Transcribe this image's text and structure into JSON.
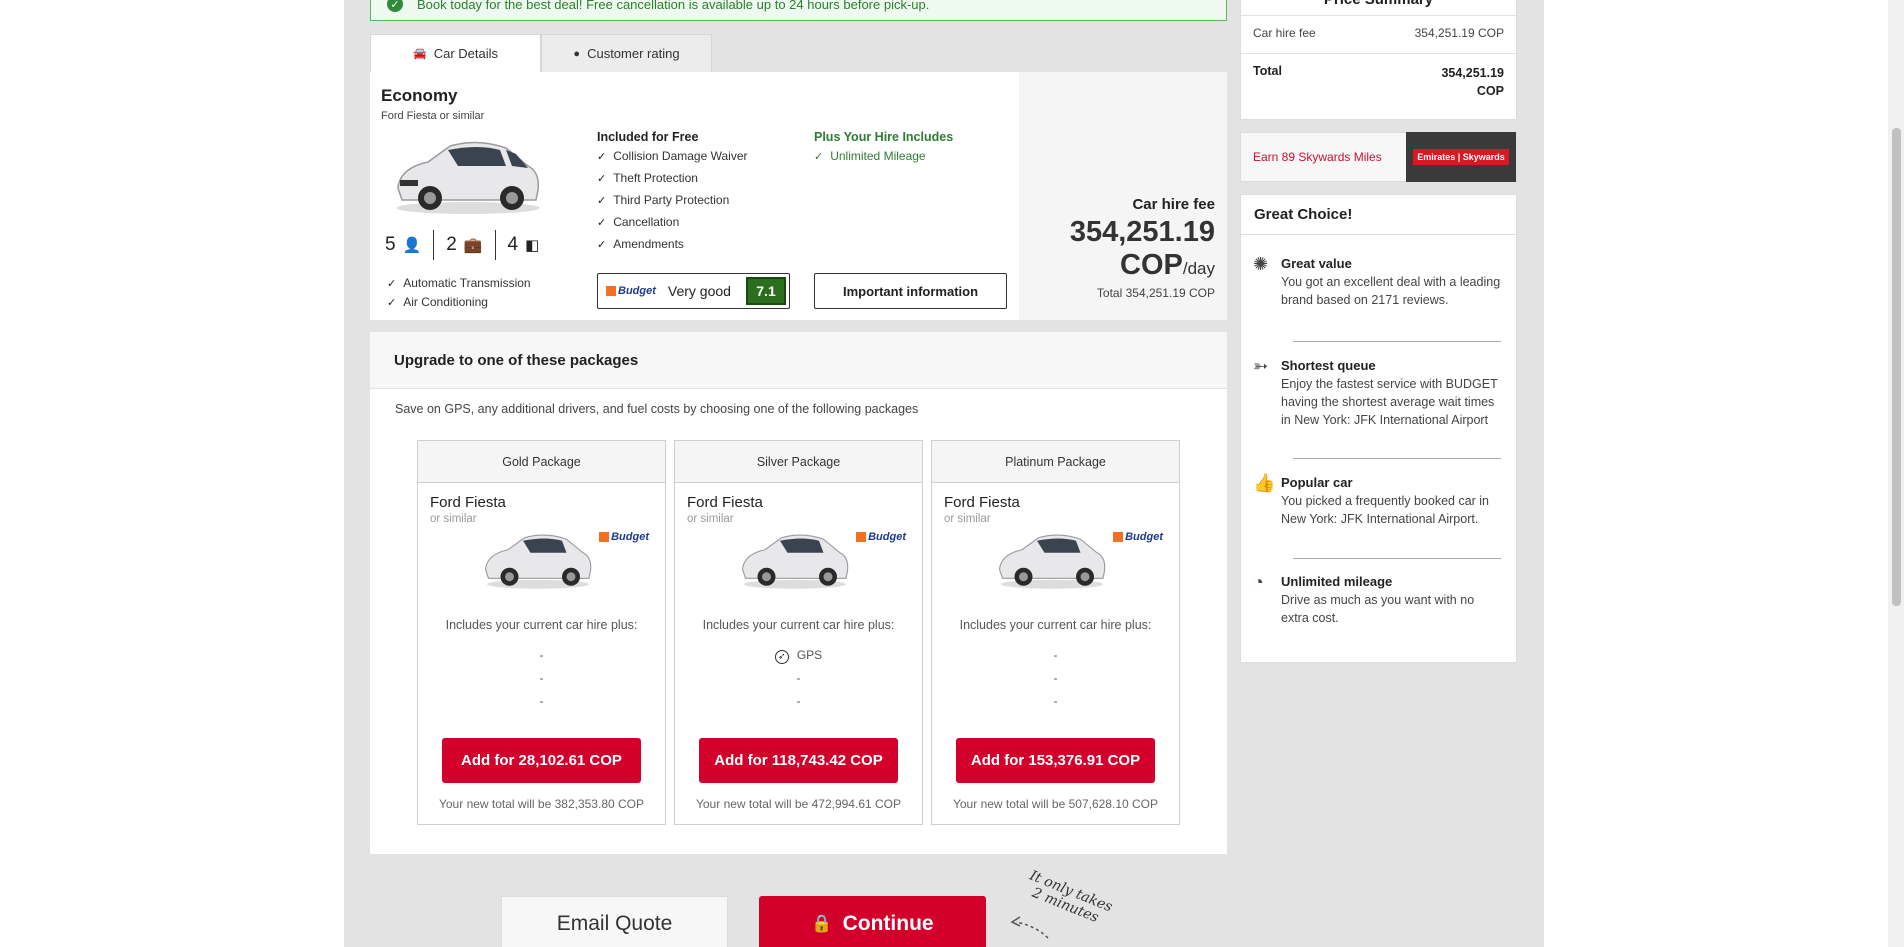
{
  "banner": {
    "text": "Book today for the best deal! Free cancellation is available up to 24 hours before pick-up."
  },
  "tabs": [
    {
      "label": "Car Details"
    },
    {
      "label": "Customer rating"
    }
  ],
  "car": {
    "class": "Economy",
    "model": "Ford Fiesta or similar",
    "seats": "5",
    "bags": "2",
    "doors": "4",
    "features": [
      "Automatic Transmission",
      "Air Conditioning"
    ],
    "included_title": "Included for Free",
    "included": [
      "Collision Damage Waiver",
      "Theft Protection",
      "Third Party Protection",
      "Cancellation",
      "Amendments"
    ],
    "plus_title": "Plus Your Hire Includes",
    "plus": [
      "Unlimited Mileage"
    ],
    "supplier": "Budget",
    "rating_label": "Very good",
    "rating_score": "7.1",
    "info_button": "Important information",
    "fee_label": "Car hire fee",
    "fee_amount": "354,251.19",
    "fee_currency": "COP",
    "fee_per": "/day",
    "fee_total": "Total 354,251.19 COP"
  },
  "packages": {
    "header": "Upgrade to one of these packages",
    "intro": "Save on GPS, any additional drivers, and fuel costs by choosing one of the following packages",
    "items": [
      {
        "title": "Gold Package",
        "car": "Ford Fiesta",
        "similar": "or similar",
        "includes": "Includes your current car hire plus:",
        "lines": [
          "-",
          "-",
          "-"
        ],
        "button": "Add for 28,102.61 COP",
        "new_total": "Your new total will be 382,353.80 COP"
      },
      {
        "title": "Silver Package",
        "car": "Ford Fiesta",
        "similar": "or similar",
        "includes": "Includes your current car hire plus:",
        "lines": [
          "GPS",
          "-",
          "-"
        ],
        "button": "Add for 118,743.42 COP",
        "new_total": "Your new total will be 472,994.61 COP"
      },
      {
        "title": "Platinum Package",
        "car": "Ford Fiesta",
        "similar": "or similar",
        "includes": "Includes your current car hire plus:",
        "lines": [
          "-",
          "-",
          "-"
        ],
        "button": "Add for 153,376.91 COP",
        "new_total": "Your new total will be 507,628.10 COP"
      }
    ]
  },
  "actions": {
    "email": "Email Quote",
    "continue": "Continue",
    "note_line1": "It only takes",
    "note_line2": "2 minutes"
  },
  "summary": {
    "title": "Price Summary",
    "fee_label": "Car hire fee",
    "fee_value": "354,251.19 COP",
    "total_label": "Total",
    "total_value_line1": "354,251.19",
    "total_value_line2": "COP"
  },
  "skywards": {
    "text": "Earn 89 Skywards Miles",
    "logo": "Emirates | Skywards"
  },
  "great_choice": {
    "title": "Great Choice!",
    "items": [
      {
        "title": "Great value",
        "text": "You got an excellent deal with a leading brand based on 2171 reviews."
      },
      {
        "title": "Shortest queue",
        "text": "Enjoy the fastest service with BUDGET having the shortest average wait times in New York: JFK International Airport"
      },
      {
        "title": "Popular car",
        "text": "You picked a frequently booked car in New York: JFK International Airport."
      },
      {
        "title": "Unlimited mileage",
        "text": "Drive as much as you want with no extra cost."
      }
    ]
  },
  "colors": {
    "brand_red": "#d3002b",
    "green": "#2e7d32",
    "rating_green": "#2b6e1f"
  }
}
